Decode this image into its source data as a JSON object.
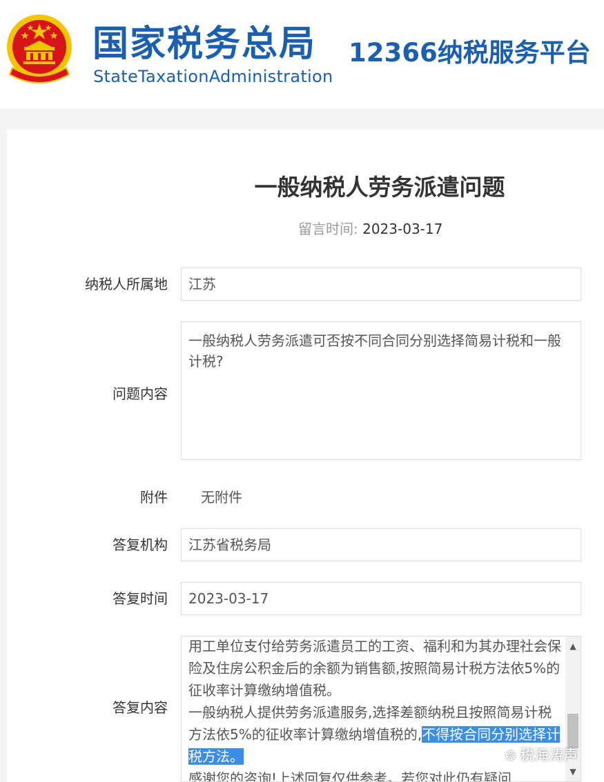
{
  "header": {
    "emblem_icon": "national-emblem-icon",
    "org_name_cn": "国家税务总局",
    "org_name_en": "StateTaxationAdministration",
    "platform_name": "12366纳税服务平台"
  },
  "article": {
    "title": "一般纳税人劳务派遣问题",
    "posted_label": "留言时间:",
    "posted_date": "2023-03-17"
  },
  "form": {
    "location": {
      "label": "纳税人所属地",
      "value": "江苏"
    },
    "question": {
      "label": "问题内容",
      "value": "一般纳税人劳务派遣可否按不同合同分别选择简易计税和一般计税?"
    },
    "attachment": {
      "label": "附件",
      "value": "无附件"
    },
    "reply_org": {
      "label": "答复机构",
      "value": "江苏省税务局"
    },
    "reply_date": {
      "label": "答复时间",
      "value": "2023-03-17"
    },
    "reply_content": {
      "label": "答复内容",
      "paragraph1": "用工单位支付给劳务派遣员工的工资、福利和为其办理社会保险及住房公积金后的余额为销售额,按照简易计税方法依5%的征收率计算缴纳增值税。",
      "paragraph2_plain": "一般纳税人提供劳务派遣服务,选择差额纳税且按照简易计税方法依5%的征收率计算缴纳增值税的,",
      "paragraph2_highlight": "不得按合同分别选择计税方法。",
      "paragraph3": "感谢您的咨询!上述回复仅供参考。若您对此仍有疑问"
    }
  },
  "watermark": {
    "icon": "wechat-icon",
    "text": "税海涛声"
  },
  "colors": {
    "brand_blue": "#1b5fb0",
    "highlight": "#3a8ee6",
    "emblem_red": "#d7141a",
    "emblem_gold": "#f5c400"
  }
}
